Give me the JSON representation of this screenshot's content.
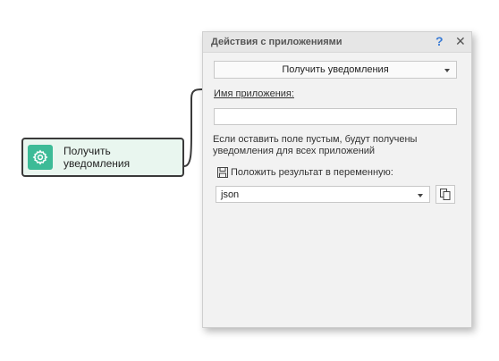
{
  "node": {
    "label": "Получить уведомления",
    "icon": "gear-icon",
    "icon_color": "#3dbb97"
  },
  "panel": {
    "title": "Действия с приложениями",
    "help_label": "?",
    "close_label": "✕",
    "action": {
      "selected": "Получить уведомления"
    },
    "app_name": {
      "label": "Имя приложения:",
      "value": ""
    },
    "hint": "Если оставить поле пустым, будут получены уведомления для всех приложений",
    "save_result": {
      "label": "Положить результат в переменную:",
      "icon": "floppy-disk-icon",
      "variable": "json",
      "copy_icon": "copy-icon"
    }
  },
  "colors": {
    "accent": "#3a7bd5",
    "node_bg": "#e9f6ef"
  }
}
